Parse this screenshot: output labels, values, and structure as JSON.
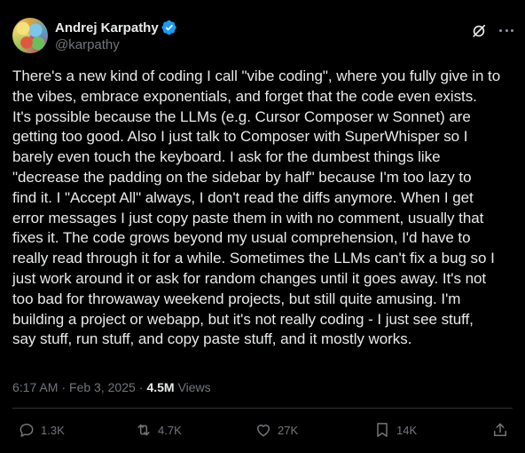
{
  "author": {
    "name": "Andrej Karpathy",
    "handle": "@karpathy",
    "verified": true,
    "verified_color": "#1d9bf0"
  },
  "icons": {
    "avatar": "avatar-image",
    "verified": "verified-badge-icon",
    "grok": "grok-icon",
    "more": "more-options-icon",
    "reply": "reply-icon",
    "repost": "repost-icon",
    "like": "like-icon",
    "bookmark": "bookmark-icon",
    "share": "share-icon"
  },
  "tweet": {
    "text": "There's a new kind of coding I call \"vibe coding\", where you fully give in to\nthe vibes, embrace exponentials, and forget that the code even exists.\nIt's possible because the LLMs (e.g. Cursor Composer w Sonnet) are\ngetting too good. Also I just talk to Composer with SuperWhisper so I\nbarely even touch the keyboard. I ask for the dumbest things like\n\"decrease the padding on the sidebar by half\" because I'm too lazy to\nfind it. I \"Accept All\" always, I don't read the diffs anymore. When I get\nerror messages I just copy paste them in with no comment, usually that\nfixes it. The code grows beyond my usual comprehension, I'd have to\nreally read through it for a while. Sometimes the LLMs can't fix a bug so I\njust work around it or ask for random changes until it goes away. It's not\ntoo bad for throwaway weekend projects, but still quite amusing. I'm\nbuilding a project or webapp, but it's not really coding - I just see stuff,\nsay stuff, run stuff, and copy paste stuff, and it mostly works."
  },
  "meta": {
    "time": "6:17 AM",
    "separator": "·",
    "date": "Feb 3, 2025",
    "views_count": "4.5M",
    "views_label": "Views"
  },
  "actions": {
    "replies": "1.3K",
    "reposts": "4.7K",
    "likes": "27K",
    "bookmarks": "14K"
  },
  "colors": {
    "background": "#000000",
    "text": "#e7e9ea",
    "muted": "#71767b",
    "divider": "#2f3336"
  }
}
